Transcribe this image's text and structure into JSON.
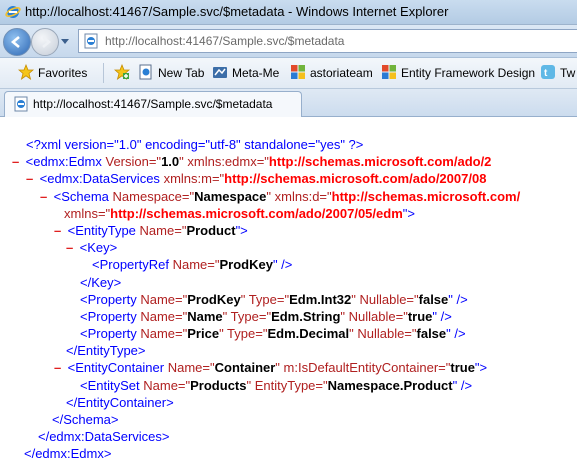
{
  "window": {
    "title": "http://localhost:41467/Sample.svc/$metadata - Windows Internet Explorer"
  },
  "address": {
    "url": "http://localhost:41467/Sample.svc/$metadata"
  },
  "favorites": {
    "label": "Favorites",
    "items": [
      "New Tab",
      "Meta-Me",
      "astoriateam",
      "Entity Framework Design",
      "Tw"
    ]
  },
  "tab": {
    "label": "http://localhost:41467/Sample.svc/$metadata"
  },
  "xml": {
    "decl": "<?xml version=\"1.0\" encoding=\"utf-8\" standalone=\"yes\" ?>",
    "edmx_open_tag": "<edmx:Edmx",
    "edmx_version_attr": "Version=\"",
    "edmx_version": "1.0",
    "edmx_ns_attr": "\" xmlns:edmx=\"",
    "edmx_ns": "http://schemas.microsoft.com/ado/2",
    "ds_open_tag": "<edmx:DataServices",
    "ds_ns_attr": "xmlns:m=\"",
    "ds_ns": "http://schemas.microsoft.com/ado/2007/08",
    "schema_open_tag": "<Schema",
    "schema_ns_attr": "Namespace=\"",
    "schema_ns": "Namespace",
    "schema_d_attr": "\" xmlns:d=\"",
    "schema_d": "http://schemas.microsoft.com/",
    "schema_xmlns_attr": "xmlns=\"",
    "schema_xmlns": "http://schemas.microsoft.com/ado/2007/05/edm",
    "schema_xmlns_close": "\">",
    "entitytype_open": "<EntityType",
    "entitytype_name_attr": "Name=\"",
    "entitytype_name": "Product",
    "entitytype_close_quote": "\">",
    "key_open": "<Key>",
    "propref_open": "<PropertyRef",
    "propref_name_attr": "Name=\"",
    "propref_name": "ProdKey",
    "propref_close": "\" />",
    "key_close": "</Key>",
    "properties": [
      {
        "name": "ProdKey",
        "type": "Edm.Int32",
        "nullable": "false"
      },
      {
        "name": "Name",
        "type": "Edm.String",
        "nullable": "true"
      },
      {
        "name": "Price",
        "type": "Edm.Decimal",
        "nullable": "false"
      }
    ],
    "prop_open": "<Property",
    "prop_name_attr": "Name=\"",
    "prop_type_attr": "\" Type=\"",
    "prop_nullable_attr": "\" Nullable=\"",
    "prop_close": "\" />",
    "entitytype_close": "</EntityType>",
    "container_open": "<EntityContainer",
    "container_name_attr": "Name=\"",
    "container_name": "Container",
    "container_default_attr": "\" m:IsDefaultEntityContainer=\"",
    "container_default": "true",
    "container_close_quote": "\">",
    "entityset_open": "<EntitySet",
    "entityset_name_attr": "Name=\"",
    "entityset_name": "Products",
    "entityset_type_attr": "\" EntityType=\"",
    "entityset_type": "Namespace.Product",
    "entityset_close": "\" />",
    "container_close": "</EntityContainer>",
    "schema_close": "</Schema>",
    "ds_close": "</edmx:DataServices>",
    "edmx_close": "</edmx:Edmx>",
    "minus": "–"
  }
}
